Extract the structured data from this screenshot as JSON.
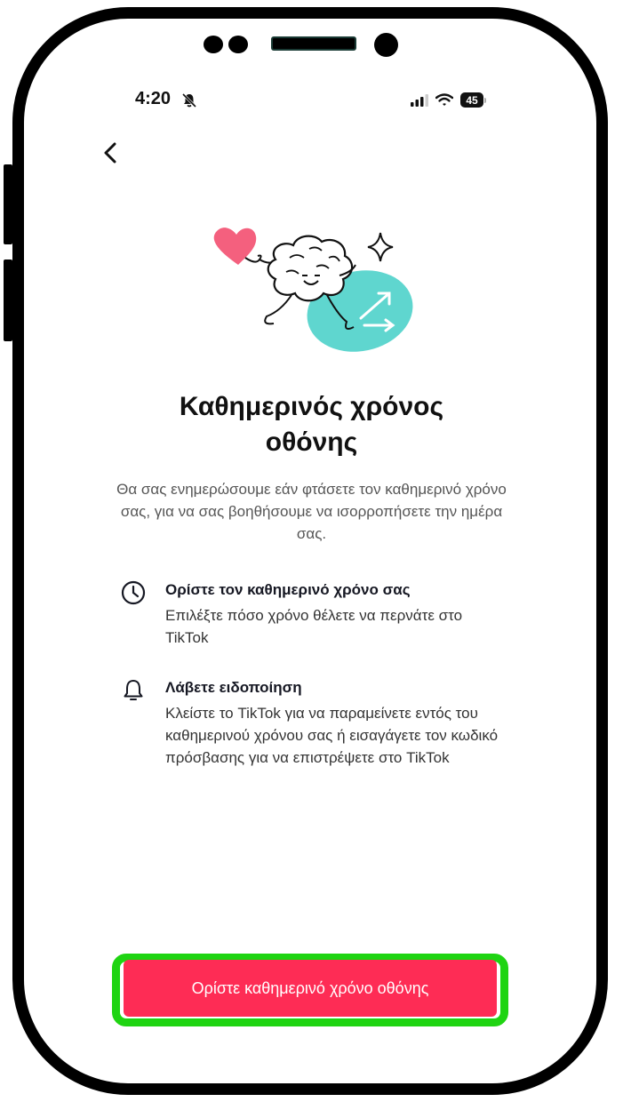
{
  "status_bar": {
    "time": "4:20",
    "battery": "45",
    "icons": [
      "bell-slash-icon",
      "signal-icon",
      "wifi-icon",
      "battery-icon"
    ]
  },
  "nav": {
    "back_icon": "chevron-left-icon"
  },
  "main": {
    "title": "Καθημερινός χρόνος οθόνης",
    "description": "Θα σας ενημερώσουμε εάν φτάσετε τον καθημερινό χρόνο σας, για να σας βοηθήσουμε να ισορροπήσετε την ημέρα σας."
  },
  "features": [
    {
      "icon": "clock-icon",
      "title": "Ορίστε τον καθημερινό χρόνο σας",
      "text": "Επιλέξτε πόσο χρόνο θέλετε να περνάτε στο TikTok"
    },
    {
      "icon": "bell-icon",
      "title": "Λάβετε ειδοποίηση",
      "text": "Κλείστε το TikTok για να παραμείνετε εντός του καθημερινού χρόνου σας ή εισαγάγετε τον κωδικό πρόσβασης για να επιστρέψετε στο TikTok"
    }
  ],
  "cta": {
    "label": "Ορίστε καθημερινό χρόνο οθόνης"
  },
  "colors": {
    "accent": "#fe2c55",
    "highlight": "#1fd412",
    "illustration_heart": "#f4607e",
    "illustration_blob": "#5fd6cf"
  }
}
